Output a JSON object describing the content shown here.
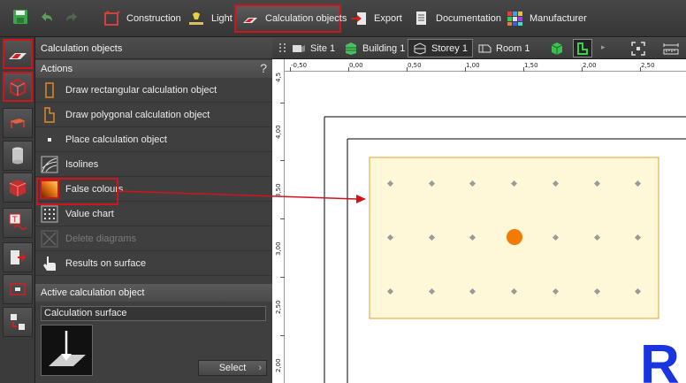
{
  "toolbar": {
    "buttons": [
      {
        "label": "Construction",
        "icon": "construction-icon"
      },
      {
        "label": "Light",
        "icon": "light-icon"
      },
      {
        "label": "Calculation objects",
        "icon": "calculation-objects-icon",
        "active": true
      },
      {
        "label": "Export",
        "icon": "export-icon"
      },
      {
        "label": "Documentation",
        "icon": "documentation-icon"
      },
      {
        "label": "Manufacturer",
        "icon": "manufacturer-icon"
      }
    ]
  },
  "panel": {
    "title": "Calculation objects",
    "actions_header": "Actions",
    "help": "?",
    "actions": [
      {
        "label": "Draw rectangular calculation object",
        "icon": "draw-rect-icon",
        "enabled": true
      },
      {
        "label": "Draw polygonal calculation object",
        "icon": "draw-polygon-icon",
        "enabled": true
      },
      {
        "label": "Place calculation object",
        "icon": "place-point-icon",
        "enabled": true
      },
      {
        "label": "Isolines",
        "icon": "isolines-icon",
        "enabled": true
      },
      {
        "label": "False colours",
        "icon": "false-colours-icon",
        "enabled": true,
        "highlight": true
      },
      {
        "label": "Value chart",
        "icon": "value-chart-icon",
        "enabled": true
      },
      {
        "label": "Delete diagrams",
        "icon": "delete-diagrams-icon",
        "enabled": false
      },
      {
        "label": "Results on surface",
        "icon": "results-on-surface-icon",
        "enabled": true
      }
    ],
    "active_header": "Active calculation object",
    "active_object": "Calculation surface",
    "select_label": "Select"
  },
  "view": {
    "tabs": [
      {
        "label": "Site 1",
        "icon": "site-icon"
      },
      {
        "label": "Building 1",
        "icon": "building-icon"
      },
      {
        "label": "Storey 1",
        "icon": "storey-icon",
        "active": true
      },
      {
        "label": "Room 1",
        "icon": "room-icon"
      }
    ]
  },
  "rulers": {
    "top": [
      "-0,50",
      "0,00",
      "0,50",
      "1,00",
      "1,50",
      "2,00",
      "2,50"
    ],
    "left": [
      "4,5",
      "4,00",
      "3,50",
      "3,00",
      "2,50",
      "2,00"
    ]
  },
  "colors": {
    "highlight": "#d0141c",
    "surface_fill": "#fff8d8",
    "surface_border": "#e0a030",
    "point": "#9a9a9a",
    "marker": "#f47a00",
    "logo": "#1a35e0"
  },
  "canvas": {
    "logo_letter": "R"
  }
}
